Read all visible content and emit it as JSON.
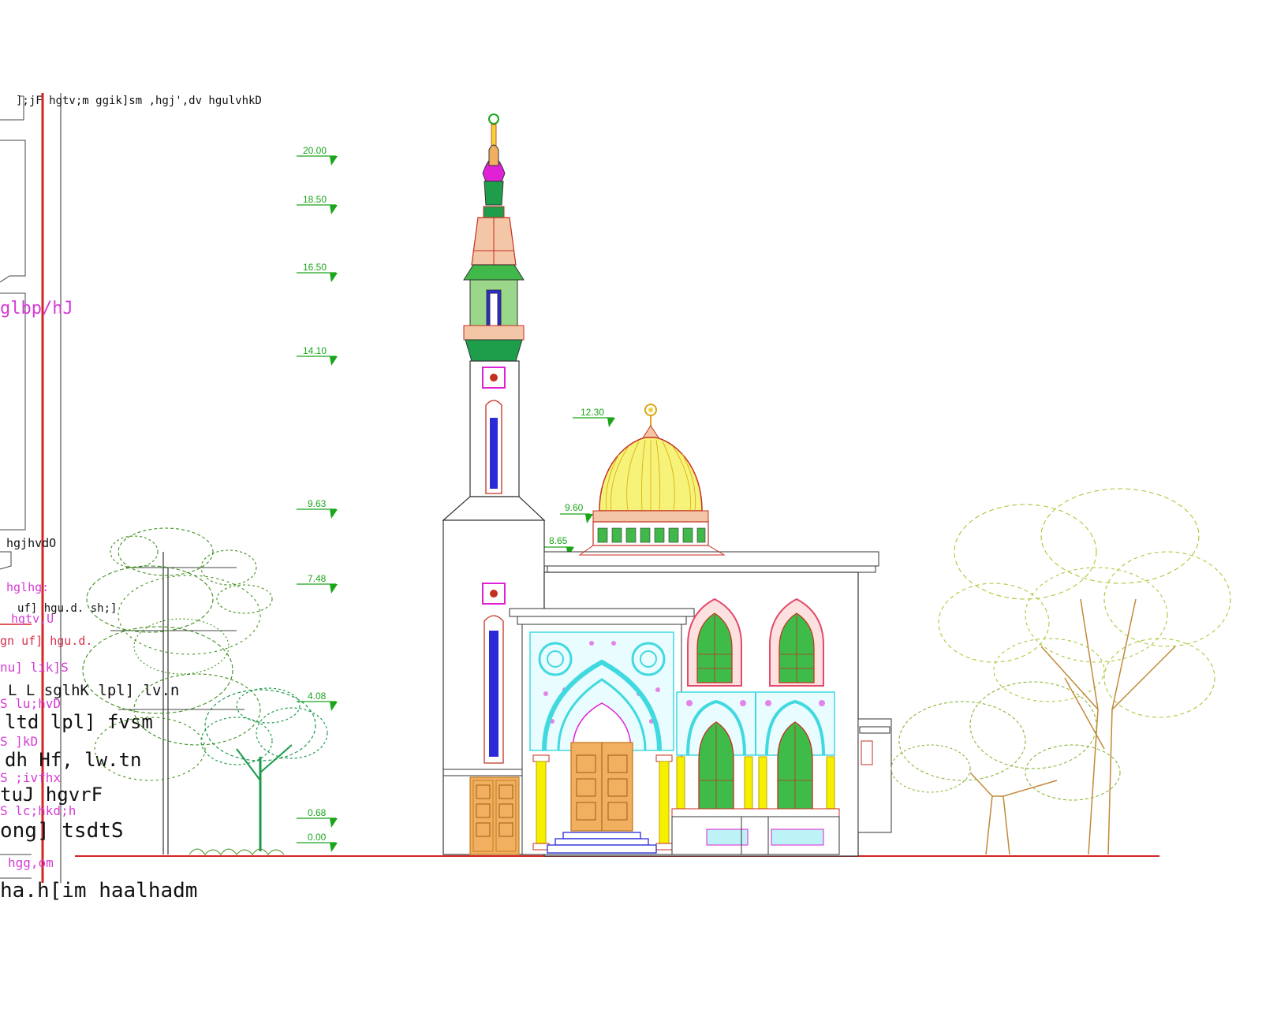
{
  "level_markers": [
    {
      "label": "20.00"
    },
    {
      "label": "18.50"
    },
    {
      "label": "16.50"
    },
    {
      "label": "14.10"
    },
    {
      "label": "12.30"
    },
    {
      "label": "9.63"
    },
    {
      "label": "9.60"
    },
    {
      "label": "8.65"
    },
    {
      "label": "7.48"
    },
    {
      "label": "4.08"
    },
    {
      "label": "0.68"
    },
    {
      "label": "0.00"
    }
  ],
  "sheet_text": {
    "header_line": "];jF hgtv;m ggik]sm ,hgj',dv hgulvhkD",
    "side_label": "glbp/hJ",
    "label_hgjhvdO": "hgjhvdO",
    "label_hglhg": "hglhg:",
    "label_ufj": "uf] hgu.d. sh;]",
    "label_hgtv": "hgtv,U",
    "label_ugn": "gn uf] hgu.d.",
    "label_lik": "nu] lik]S",
    "label_sglhk": "L L sglhK lpl] lv.n",
    "label_luhvd": "S lu;hvD",
    "label_ltd": "ltd lpl] fvsm",
    "label_jkd": "S ]kD",
    "label_dh": "dh Hf, lw.tn",
    "label_ivfhx": "S ;ivfhx",
    "label_tuj": "tuJ hgvrF",
    "label_lchkd": "S lc;hkd;h",
    "label_ong": "ong] tsdtS",
    "label_hggom": "hgg,om",
    "footer_title": "ha.h[im haalhadm"
  },
  "colors": {
    "level_green": "#1aa51a",
    "grid_red": "#d42424",
    "dome_yellow": "#f7f27a",
    "arch_cyan": "#41d9e0",
    "accent_magenta": "#e021d6",
    "door_orange": "#f0b060",
    "column_yellow": "#f5f000",
    "tree_green_dark": "#3f8f1c",
    "tree_green_light": "#a9c93a",
    "tree_trunk": "#c08a3a",
    "minaret_green": "#1e9e4a",
    "minaret_blue": "#2a2ad8"
  }
}
